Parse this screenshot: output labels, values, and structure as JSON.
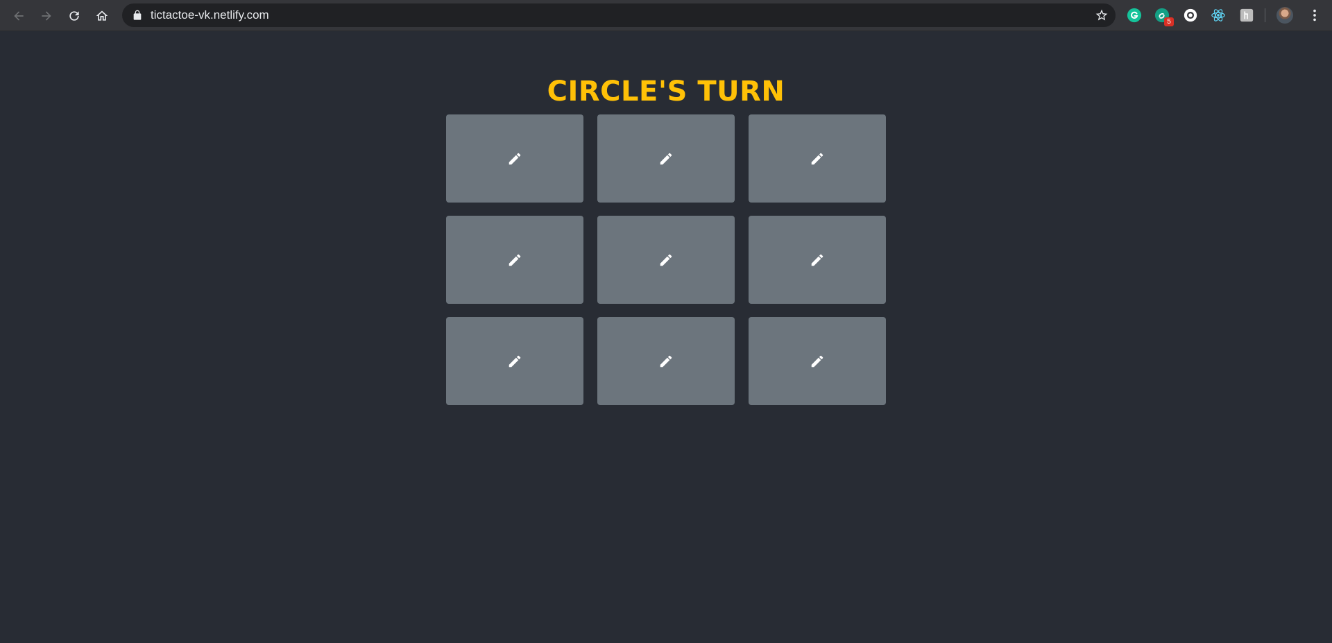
{
  "browser": {
    "url": "tictactoe-vk.netlify.com",
    "extensions": [
      {
        "name": "grammarly-icon",
        "color": "#15c39a"
      },
      {
        "name": "extension-badge-icon",
        "color": "#14a085",
        "badge": "5"
      },
      {
        "name": "extension-round-icon",
        "color": "#ffffff"
      },
      {
        "name": "react-devtools-icon",
        "color": "#61dafb"
      },
      {
        "name": "extension-square-icon",
        "color": "#bdbdbd"
      }
    ]
  },
  "game": {
    "status": "CIRCLE'S TURN",
    "status_color": "#ffc107",
    "cells": [
      {
        "icon": "pencil-icon"
      },
      {
        "icon": "pencil-icon"
      },
      {
        "icon": "pencil-icon"
      },
      {
        "icon": "pencil-icon"
      },
      {
        "icon": "pencil-icon"
      },
      {
        "icon": "pencil-icon"
      },
      {
        "icon": "pencil-icon"
      },
      {
        "icon": "pencil-icon"
      },
      {
        "icon": "pencil-icon"
      }
    ]
  },
  "colors": {
    "page_bg": "#282c34",
    "cell_bg": "#6c757d",
    "accent": "#ffc107"
  }
}
